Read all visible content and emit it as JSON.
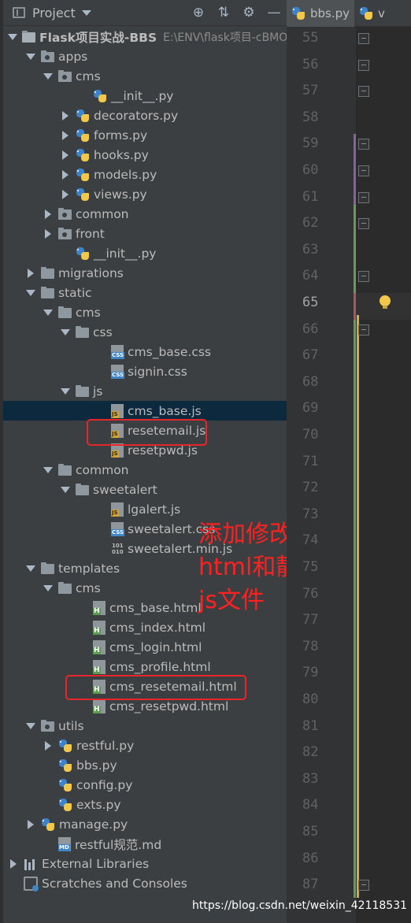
{
  "header": {
    "title": "Project",
    "icons": [
      "globe-icon",
      "collapse-icon",
      "gear-icon",
      "minimize-icon"
    ]
  },
  "tabs": [
    {
      "label": "bbs.py",
      "icon": "python-file-icon"
    },
    {
      "label": "v",
      "icon": "python-file-icon"
    }
  ],
  "tree": [
    {
      "depth": 0,
      "arrow": "down",
      "icon": "folder-root",
      "label": "Flask项目实战-BBS",
      "path": "E:\\ENV\\flask项目-cBMOs",
      "bold": true
    },
    {
      "depth": 1,
      "arrow": "down",
      "icon": "folder-pkg",
      "label": "apps"
    },
    {
      "depth": 2,
      "arrow": "down",
      "icon": "folder-pkg",
      "label": "cms"
    },
    {
      "depth": 4,
      "arrow": "none",
      "icon": "py",
      "label": "__init__.py"
    },
    {
      "depth": 3,
      "arrow": "right",
      "icon": "py",
      "label": "decorators.py"
    },
    {
      "depth": 3,
      "arrow": "right",
      "icon": "py",
      "label": "forms.py"
    },
    {
      "depth": 3,
      "arrow": "right",
      "icon": "py",
      "label": "hooks.py"
    },
    {
      "depth": 3,
      "arrow": "right",
      "icon": "py",
      "label": "models.py"
    },
    {
      "depth": 3,
      "arrow": "right",
      "icon": "py",
      "label": "views.py"
    },
    {
      "depth": 2,
      "arrow": "right",
      "icon": "folder-pkg",
      "label": "common"
    },
    {
      "depth": 2,
      "arrow": "right",
      "icon": "folder-pkg",
      "label": "front"
    },
    {
      "depth": 3,
      "arrow": "none",
      "icon": "py",
      "label": "__init__.py"
    },
    {
      "depth": 1,
      "arrow": "right",
      "icon": "folder",
      "label": "migrations"
    },
    {
      "depth": 1,
      "arrow": "down",
      "icon": "folder",
      "label": "static"
    },
    {
      "depth": 2,
      "arrow": "down",
      "icon": "folder",
      "label": "cms"
    },
    {
      "depth": 3,
      "arrow": "down",
      "icon": "folder",
      "label": "css"
    },
    {
      "depth": 5,
      "arrow": "none",
      "icon": "css",
      "label": "cms_base.css"
    },
    {
      "depth": 5,
      "arrow": "none",
      "icon": "css",
      "label": "signin.css"
    },
    {
      "depth": 3,
      "arrow": "down",
      "icon": "folder",
      "label": "js"
    },
    {
      "depth": 5,
      "arrow": "none",
      "icon": "js",
      "label": "cms_base.js",
      "selected": true
    },
    {
      "depth": 5,
      "arrow": "none",
      "icon": "js",
      "label": "resetemail.js"
    },
    {
      "depth": 5,
      "arrow": "none",
      "icon": "js",
      "label": "resetpwd.js"
    },
    {
      "depth": 2,
      "arrow": "down",
      "icon": "folder",
      "label": "common"
    },
    {
      "depth": 3,
      "arrow": "down",
      "icon": "folder",
      "label": "sweetalert"
    },
    {
      "depth": 5,
      "arrow": "none",
      "icon": "js",
      "label": "lgalert.js"
    },
    {
      "depth": 5,
      "arrow": "none",
      "icon": "css",
      "label": "sweetalert.css"
    },
    {
      "depth": 5,
      "arrow": "none",
      "icon": "bin",
      "label": "sweetalert.min.js"
    },
    {
      "depth": 1,
      "arrow": "down",
      "icon": "folder",
      "label": "templates"
    },
    {
      "depth": 2,
      "arrow": "down",
      "icon": "folder",
      "label": "cms"
    },
    {
      "depth": 4,
      "arrow": "none",
      "icon": "html",
      "label": "cms_base.html"
    },
    {
      "depth": 4,
      "arrow": "none",
      "icon": "html",
      "label": "cms_index.html"
    },
    {
      "depth": 4,
      "arrow": "none",
      "icon": "html",
      "label": "cms_login.html"
    },
    {
      "depth": 4,
      "arrow": "none",
      "icon": "html",
      "label": "cms_profile.html"
    },
    {
      "depth": 4,
      "arrow": "none",
      "icon": "html",
      "label": "cms_resetemail.html"
    },
    {
      "depth": 4,
      "arrow": "none",
      "icon": "html",
      "label": "cms_resetpwd.html"
    },
    {
      "depth": 1,
      "arrow": "down",
      "icon": "folder-pkg",
      "label": "utils"
    },
    {
      "depth": 2,
      "arrow": "right",
      "icon": "py",
      "label": "restful.py"
    },
    {
      "depth": 2,
      "arrow": "none",
      "icon": "py",
      "label": "bbs.py"
    },
    {
      "depth": 2,
      "arrow": "none",
      "icon": "py",
      "label": "config.py"
    },
    {
      "depth": 2,
      "arrow": "none",
      "icon": "py",
      "label": "exts.py"
    },
    {
      "depth": 1,
      "arrow": "right",
      "icon": "py",
      "label": "manage.py"
    },
    {
      "depth": 2,
      "arrow": "none",
      "icon": "md",
      "label": "restful规范.md"
    },
    {
      "depth": 0,
      "arrow": "right",
      "icon": "lib",
      "label": "External Libraries"
    },
    {
      "depth": 0,
      "arrow": "none",
      "icon": "scratch",
      "label": "Scratches and Consoles"
    }
  ],
  "line_numbers": [
    "55",
    "56",
    "57",
    "58",
    "59",
    "60",
    "61",
    "62",
    "63",
    "64",
    "65",
    "66",
    "67",
    "68",
    "69",
    "70",
    "71",
    "72",
    "73",
    "74",
    "75",
    "76",
    "77",
    "78",
    "79",
    "80",
    "81",
    "82",
    "83",
    "84",
    "85",
    "86",
    "87"
  ],
  "current_line": "65",
  "annotation": {
    "lines": [
      "添加修改邮箱的",
      "html和静态资源",
      "js文件"
    ]
  },
  "watermark": "https://blog.csdn.net/weixin_42118531",
  "colors": {
    "panel_bg": "#3c3f41",
    "selected_row": "#0d293e",
    "highlight_red": "#e8262a",
    "annotation_red": "#ff2020"
  }
}
